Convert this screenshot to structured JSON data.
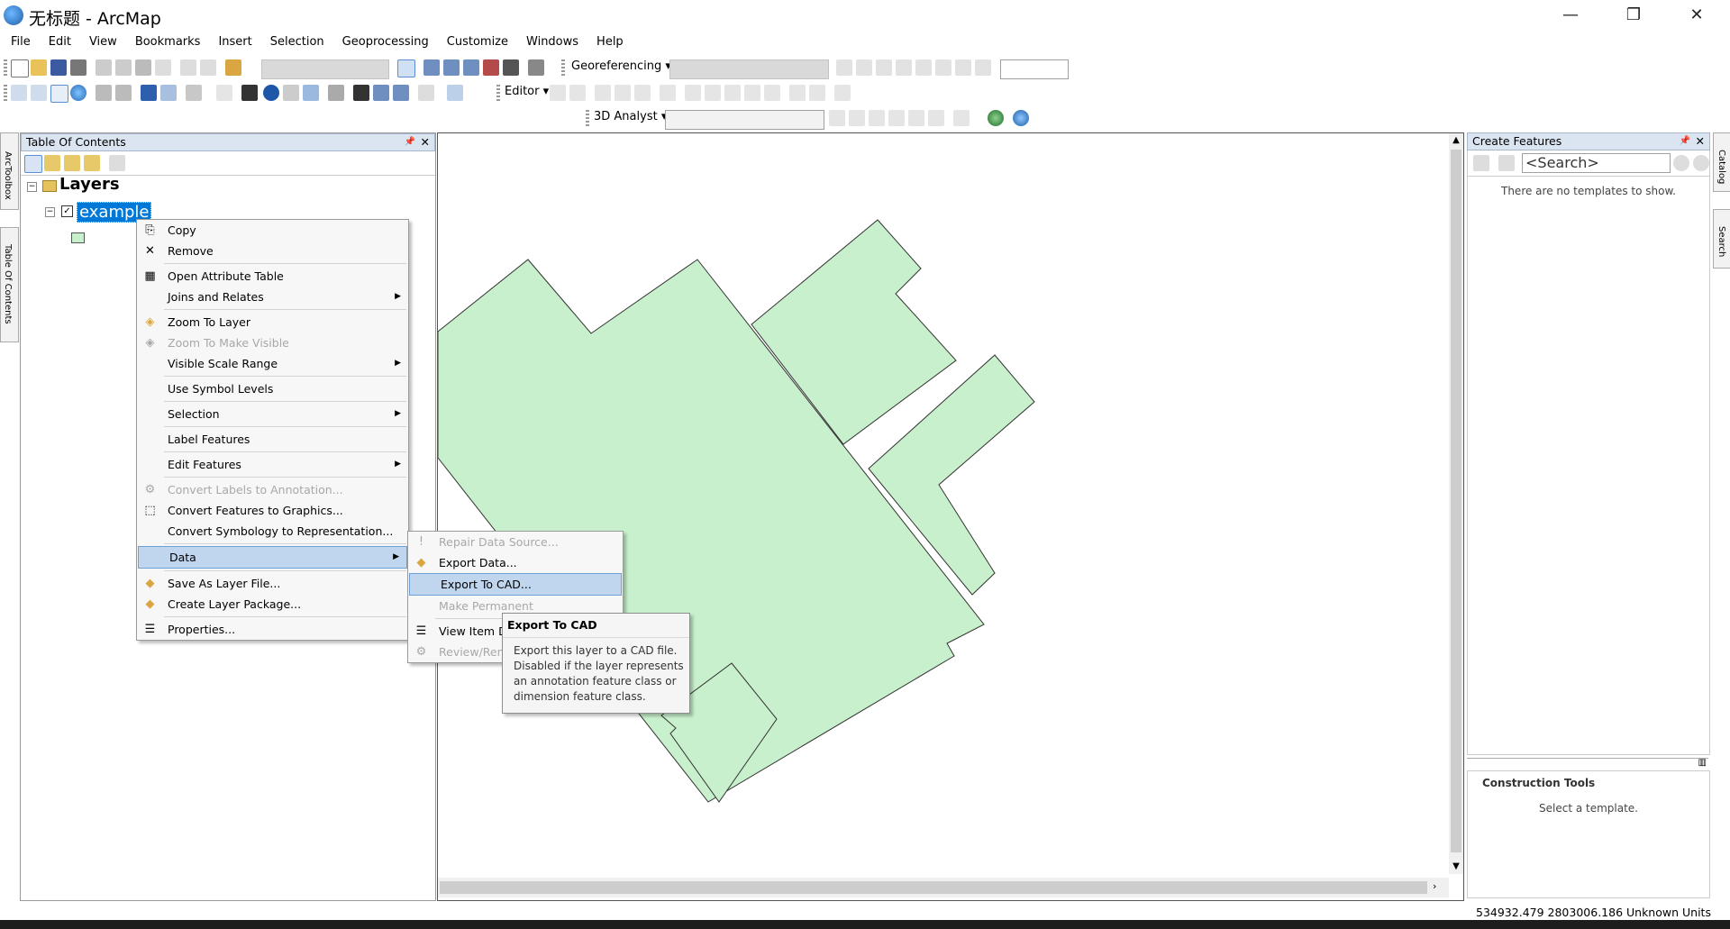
{
  "window": {
    "title": "无标题 - ArcMap",
    "minimize": "—",
    "restore": "❐",
    "close": "✕"
  },
  "menubar": [
    "File",
    "Edit",
    "View",
    "Bookmarks",
    "Insert",
    "Selection",
    "Geoprocessing",
    "Customize",
    "Windows",
    "Help"
  ],
  "toolbars": {
    "georeferencing_label": "Georeferencing ▾",
    "editor_label": "Editor ▾",
    "analyst_label": "3D Analyst ▾"
  },
  "side_tabs": {
    "arctoolbox": "ArcToolbox",
    "toc": "Table Of Contents",
    "catalog": "Catalog",
    "search": "Search"
  },
  "toc": {
    "title": "Table Of Contents",
    "pin": "ᵖ",
    "close": "✕",
    "root": "Layers",
    "layer": "example"
  },
  "context_menu": {
    "items": [
      {
        "label": "Copy",
        "icon": "copy-icon",
        "glyph": "⎘"
      },
      {
        "label": "Remove",
        "icon": "remove-icon",
        "glyph": "✕"
      },
      {
        "label": "Open Attribute Table",
        "icon": "table-icon",
        "glyph": "▦"
      },
      {
        "label": "Joins and Relates",
        "icon": "",
        "glyph": ""
      },
      {
        "label": "Zoom To Layer",
        "icon": "zoom-layer-icon",
        "glyph": "◈"
      },
      {
        "label": "Zoom To Make Visible",
        "icon": "zoom-visible-icon",
        "glyph": "◈"
      },
      {
        "label": "Visible Scale Range",
        "icon": "",
        "glyph": ""
      },
      {
        "label": "Use Symbol Levels",
        "icon": "",
        "glyph": ""
      },
      {
        "label": "Selection",
        "icon": "",
        "glyph": ""
      },
      {
        "label": "Label Features",
        "icon": "",
        "glyph": ""
      },
      {
        "label": "Edit Features",
        "icon": "",
        "glyph": ""
      },
      {
        "label": "Convert Labels to Annotation...",
        "icon": "convert-labels-icon",
        "glyph": "⚙"
      },
      {
        "label": "Convert Features to Graphics...",
        "icon": "convert-features-icon",
        "glyph": "⬚"
      },
      {
        "label": "Convert Symbology to Representation...",
        "icon": "",
        "glyph": ""
      },
      {
        "label": "Data",
        "icon": "",
        "glyph": ""
      },
      {
        "label": "Save As Layer File...",
        "icon": "save-layer-icon",
        "glyph": "◆"
      },
      {
        "label": "Create Layer Package...",
        "icon": "layer-package-icon",
        "glyph": "◆"
      },
      {
        "label": "Properties...",
        "icon": "properties-icon",
        "glyph": "☰"
      }
    ]
  },
  "data_submenu": {
    "items": [
      {
        "label": "Repair Data Source...",
        "glyph": "!"
      },
      {
        "label": "Export Data...",
        "glyph": "◆"
      },
      {
        "label": "Export To CAD...",
        "glyph": ""
      },
      {
        "label": "Make Permanent",
        "glyph": ""
      },
      {
        "label": "View Item D",
        "glyph": "☰"
      },
      {
        "label": "Review/Rem",
        "glyph": "⚙"
      }
    ]
  },
  "tooltip": {
    "title": "Export To CAD",
    "body": "Export this layer to a CAD file. Disabled if the layer represents an annotation feature class or dimension feature class."
  },
  "create_features": {
    "title": "Create Features",
    "search_placeholder": "<Search>",
    "empty_message": "There are no templates to show.",
    "construction_title": "Construction Tools",
    "construction_message": "Select a template."
  },
  "status": {
    "coords": "534932.479  2803006.186 Unknown Units"
  },
  "colors": {
    "polygon_fill": "#c8f0cc",
    "polygon_stroke": "#333333",
    "accent": "#3399ff"
  }
}
